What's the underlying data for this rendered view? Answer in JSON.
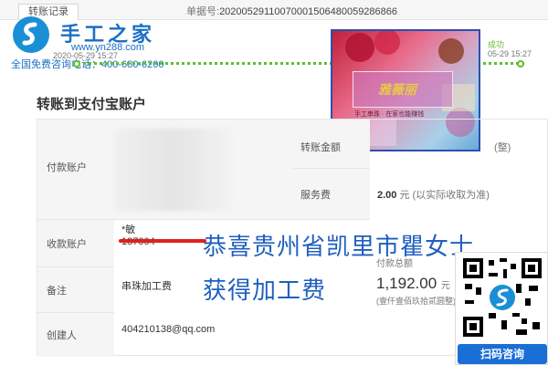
{
  "header": {
    "tab_label": "转账记录",
    "order_label": "单据号:",
    "order_number": "20200529110070001506480059286866"
  },
  "logo": {
    "title": "手工之家",
    "url": "www.yn288.com",
    "date": "2020-05-29 15:27",
    "phone": "全国免费咨询电话：400-680-6200"
  },
  "progress": {
    "done_label": "成功",
    "done_date": "05-29 15:27"
  },
  "promo": {
    "brand": "雅薇丽",
    "fine_print": "手工串珠 · 在家也能赚钱"
  },
  "section": {
    "title": "转账到支付宝账户"
  },
  "rows": {
    "payer_label": "付款账户",
    "amount_label": "转账金额",
    "amount_note": "(整)",
    "fee_label": "服务费",
    "fee_value": "2.00",
    "fee_unit": "元",
    "fee_note": "(以实际收取为准)",
    "payee_label": "收款账户",
    "payee_name": "*敏",
    "payee_account": "187004",
    "memo_label": "备注",
    "memo_value": "串珠加工费",
    "creator_label": "创建人",
    "creator_value": "404210138@qq.com"
  },
  "overlay": {
    "line1": "恭喜贵州省凯里市瞿女士",
    "line2": "获得加工费"
  },
  "payment": {
    "label": "付款总额",
    "value": "1,192.00",
    "unit": "元",
    "in_words": "(壹仟壹佰玖拾贰圆整)"
  },
  "qr": {
    "label": "扫码咨询"
  },
  "colors": {
    "brand_blue": "#1a6fc4",
    "success_green": "#5fbf2a",
    "promo_blue": "#1f5fbf",
    "alert_red": "#e02020"
  }
}
